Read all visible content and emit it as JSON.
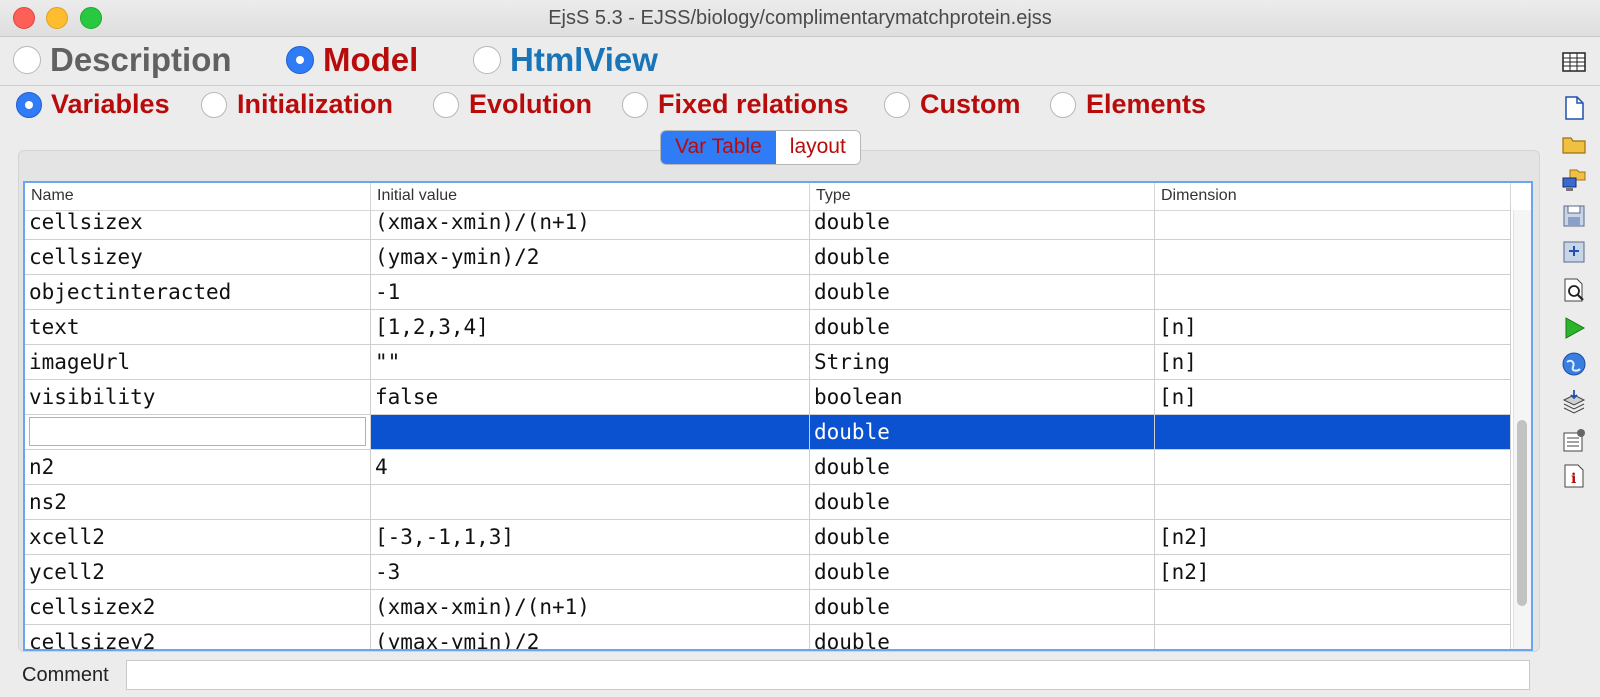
{
  "window": {
    "title": "EjsS 5.3 - EJSS/biology/complimentarymatchprotein.ejss"
  },
  "top_tabs": [
    {
      "label": "Description",
      "color": "#616161"
    },
    {
      "label": "Model",
      "color": "#b80c0c"
    },
    {
      "label": "HtmlView",
      "color": "#1a75b8"
    }
  ],
  "top_selected": "Model",
  "model_tabs": [
    "Variables",
    "Initialization",
    "Evolution",
    "Fixed relations",
    "Custom",
    "Elements"
  ],
  "model_selected": "Variables",
  "segments": [
    {
      "label": "Var Table",
      "active": true
    },
    {
      "label": "layout",
      "active": false
    }
  ],
  "table": {
    "headers": [
      "Name",
      "Initial value",
      "Type",
      "Dimension"
    ],
    "rows": [
      [
        "cellsizex",
        "(xmax-xmin)/(n+1)",
        "double",
        ""
      ],
      [
        "cellsizey",
        "(ymax-ymin)/2",
        "double",
        ""
      ],
      [
        "objectinteracted",
        "-1",
        "double",
        ""
      ],
      [
        "text",
        "[1,2,3,4]",
        "double",
        "[n]"
      ],
      [
        "imageUrl",
        "\"\"",
        "String",
        "[n]"
      ],
      [
        "visibility",
        "false",
        "boolean",
        "[n]"
      ],
      [
        "",
        "",
        "double",
        ""
      ],
      [
        "n2",
        "4",
        "double",
        ""
      ],
      [
        "ns2",
        "",
        "double",
        ""
      ],
      [
        "xcell2",
        "[-3,-1,1,3]",
        "double",
        "[n2]"
      ],
      [
        "ycell2",
        "-3",
        "double",
        "[n2]"
      ],
      [
        "cellsizex2",
        "(xmax-xmin)/(n+1)",
        "double",
        ""
      ],
      [
        "cellsizey2",
        "(ymax-ymin)/2",
        "double",
        ""
      ]
    ],
    "selected_row": 6
  },
  "comment": {
    "label": "Comment",
    "value": ""
  },
  "right_toolbar": [
    "table-view-icon",
    "new-file-icon",
    "open-folder-icon",
    "open-remote-icon",
    "save-icon",
    "save-as-icon",
    "search-icon",
    "run-icon",
    "web-icon",
    "package-icon",
    "preferences-icon",
    "info-icon"
  ]
}
